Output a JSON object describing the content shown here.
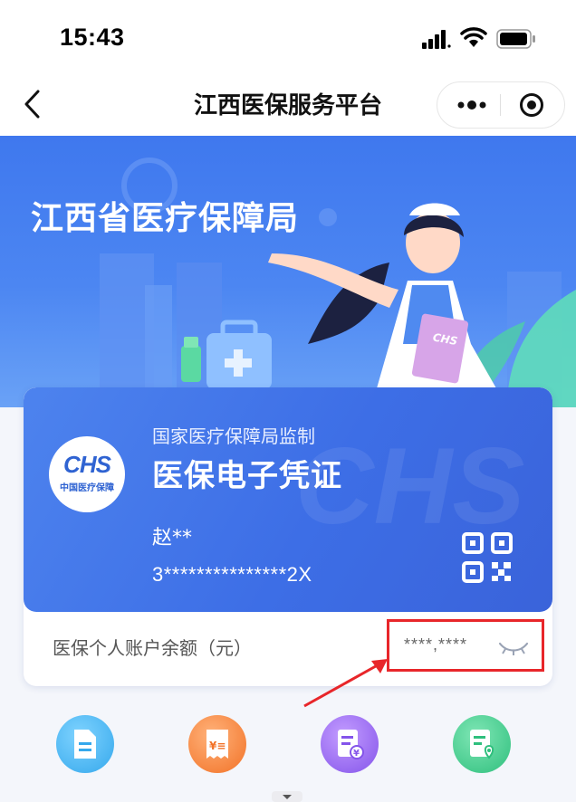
{
  "status_bar": {
    "time": "15:43"
  },
  "nav": {
    "title": "江西医保服务平台"
  },
  "banner": {
    "title": "江西省医疗保障局"
  },
  "card": {
    "logo_text": "CHS",
    "logo_cn": "中国医疗保障",
    "supervised_by": "国家医疗保障局监制",
    "title": "医保电子凭证",
    "holder_name": "赵**",
    "holder_id": "3***************2X",
    "balance_label": "医保个人账户余额（元）",
    "balance_value": "****,****"
  },
  "colors": {
    "accent": "#3f78ee",
    "annotation": "#e8262a"
  },
  "services": [
    {
      "icon": "document-icon"
    },
    {
      "icon": "invoice-icon"
    },
    {
      "icon": "bill-payment-icon"
    },
    {
      "icon": "location-record-icon"
    }
  ]
}
